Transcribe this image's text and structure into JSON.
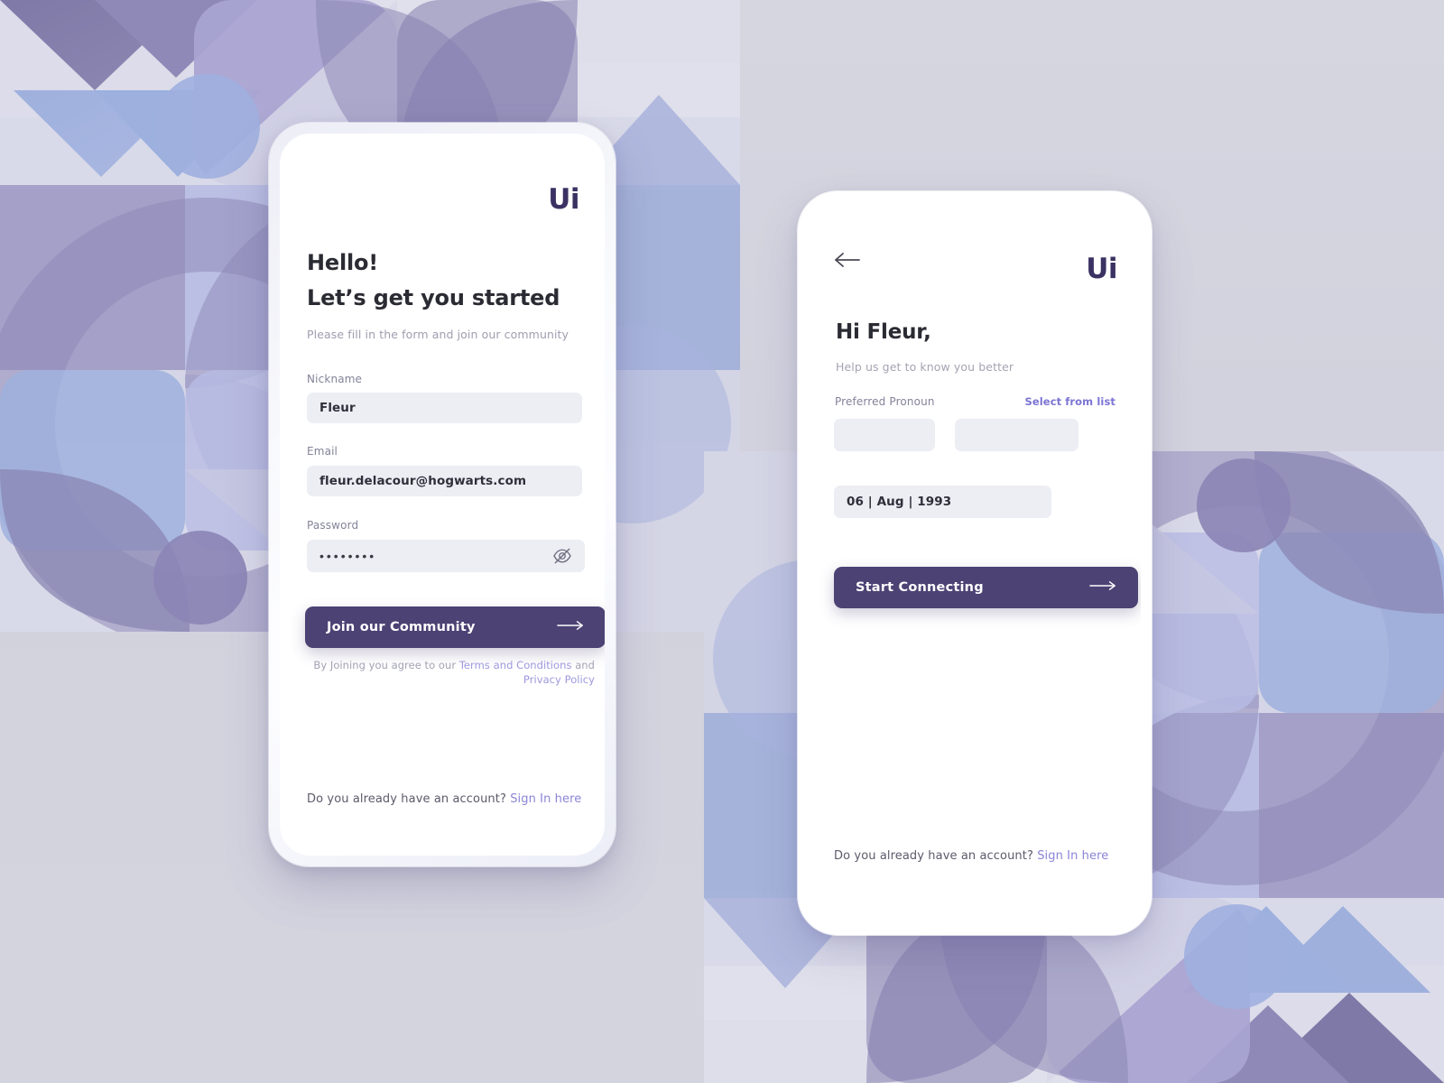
{
  "theme": {
    "background": "#d2d2de",
    "accent_dark": "#4c4274",
    "accent_link": "#7b74d4",
    "field_bg": "#eceef3",
    "logo_color": "#3b3263"
  },
  "screen_one": {
    "logo": "Ui",
    "heading": "Hello!",
    "subheading": "Let’s get you started",
    "note": "Please fill in the form and join our community",
    "fields": [
      {
        "label": "Nickname",
        "value": "Fleur",
        "type": "text"
      },
      {
        "label": "Email",
        "value": "fleur.delacour@hogwarts.com",
        "type": "email"
      },
      {
        "label": "Password",
        "value": "••••••••",
        "type": "password",
        "toggle_icon": "eye-off-icon"
      }
    ],
    "cta": {
      "label": "Join our Community",
      "icon": "arrow-right-icon"
    },
    "terms": {
      "prefix": "By Joining you agree to our ",
      "link_terms": "Terms and Conditions",
      "middle": " and",
      "link_privacy": "Privacy Policy"
    },
    "footer": {
      "text": "Do you already have an account? ",
      "link": "Sign In here"
    }
  },
  "screen_two": {
    "logo": "Ui",
    "back_icon": "arrow-left-icon",
    "heading": "Hi Fleur,",
    "note": "Help us get to know you better",
    "pronoun": {
      "label": "Preferred Pronoun",
      "select_link": "Select from list",
      "box_one_value": "",
      "box_two_value": ""
    },
    "birthdate": {
      "value": "06 | Aug | 1993"
    },
    "cta": {
      "label": "Start Connecting",
      "icon": "arrow-right-icon"
    },
    "footer": {
      "text": "Do you already have an account? ",
      "link": "Sign In here"
    }
  }
}
